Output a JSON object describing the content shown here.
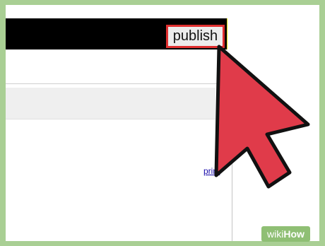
{
  "toolbar": {
    "publish_label": "publish"
  },
  "content": {
    "print_link": "print"
  },
  "watermark": {
    "wiki": "wiki",
    "how": "How"
  },
  "icons": {
    "cursor": "mouse-pointer-icon"
  },
  "colors": {
    "accent": "#e03b4a",
    "frame": "#a9cf94",
    "bar": "#000000"
  }
}
